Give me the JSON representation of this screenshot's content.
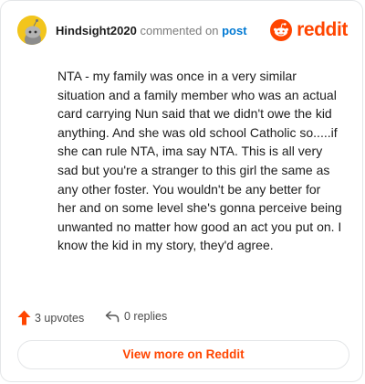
{
  "comment": {
    "username": "Hindsight2020",
    "action_text": "commented on",
    "post_link_label": "post",
    "body": "NTA - my family was once in a very similar situation and a family member who was an actual card carrying Nun said that we didn't owe the kid anything. And she was old school Catholic so.....if she can rule NTA, ima say NTA. This is all very sad but you're a stranger to this girl the same as any other foster. You wouldn't be any better for her and on some level she's gonna perceive being unwanted no matter how good an act you put on. I know the kid in my story, they'd agree."
  },
  "brand": {
    "name": "reddit",
    "icon": "reddit-snoo-icon",
    "color": "#ff4500"
  },
  "stats": {
    "upvotes_label": "3 upvotes",
    "replies_label": "0 replies",
    "upvote_icon": "upvote-arrow-icon",
    "reply_icon": "reply-arrow-icon",
    "upvote_color": "#ff4500"
  },
  "actions": {
    "view_more_label": "View more on Reddit"
  },
  "avatar": {
    "icon": "snoo-avatar-icon",
    "background": "#f2c51c"
  }
}
